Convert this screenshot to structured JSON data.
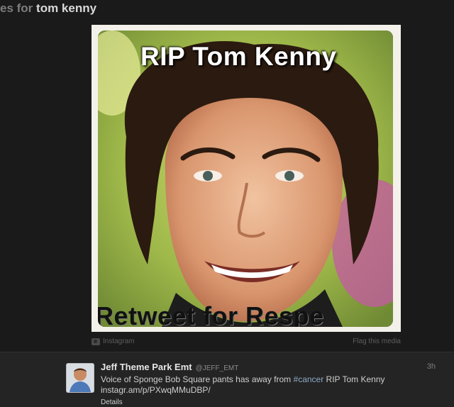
{
  "header": {
    "prefix": "es for",
    "query": "tom kenny"
  },
  "media": {
    "overlay_top": "RIP Tom Kenny",
    "overlay_bottom": "Retweet for Respe",
    "source_label": "Instagram",
    "flag_label": "Flag this media",
    "source_icon": "camera-icon"
  },
  "tweet": {
    "author_name": "Jeff Theme Park Emt",
    "author_handle": "@JEFF_EMT",
    "time": "3h",
    "text_before": "Voice of Sponge Bob Square pants has away from ",
    "hashtag": "#cancer",
    "text_after": " RIP Tom Kenny",
    "link": "instagr.am/p/PXwqMMuDBP/",
    "details_label": "Details"
  },
  "colors": {
    "background": "#1a1a1a",
    "tweet_background": "#242424",
    "hashtag": "#8fa9c7"
  }
}
